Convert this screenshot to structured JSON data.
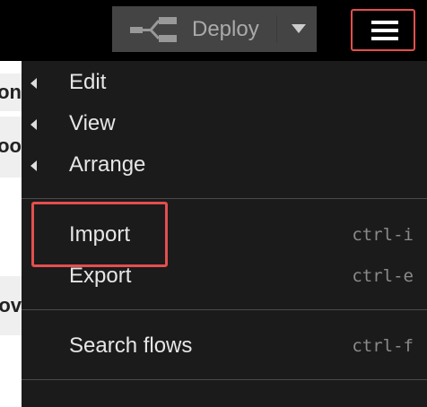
{
  "header": {
    "deploy_label": "Deploy",
    "deploy_icon": "flow-nodes-icon",
    "menu_icon": "hamburger-icon"
  },
  "workspace": {
    "rows": [
      "con",
      "roo",
      "lov"
    ]
  },
  "menu": {
    "items": [
      {
        "label": "Edit",
        "has_submenu": true
      },
      {
        "label": "View",
        "has_submenu": true
      },
      {
        "label": "Arrange",
        "has_submenu": true
      },
      {
        "label": "Import",
        "shortcut": "ctrl-i"
      },
      {
        "label": "Export",
        "shortcut": "ctrl-e"
      },
      {
        "label": "Search flows",
        "shortcut": "ctrl-f"
      }
    ]
  },
  "colors": {
    "header_bg": "#000000",
    "deploy_bg": "#444444",
    "menu_bg": "#1b1b1b",
    "highlight": "#e54e4e"
  }
}
